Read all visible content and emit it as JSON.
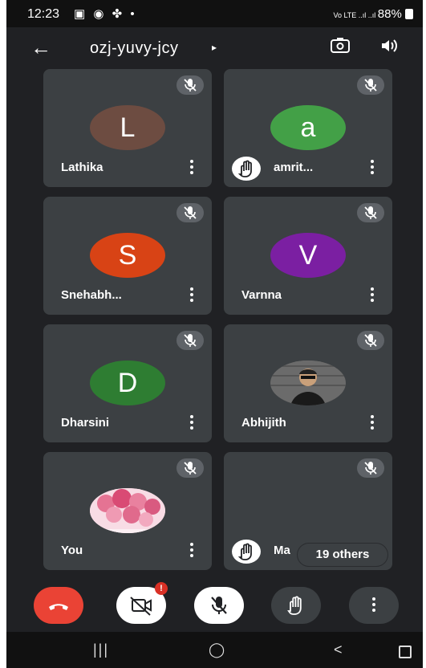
{
  "status_bar": {
    "time": "12:23",
    "left_icons": "▣ ◉ ✤ •",
    "right_text": "Vo LTE ..ıl ..ıl 88%",
    "battery": "88%"
  },
  "meeting": {
    "code": "ozj-yuvy-jcy",
    "caret": "▸"
  },
  "participants": [
    {
      "name": "Lathika",
      "initial": "L",
      "avatar_color": "#6d4c41",
      "muted": true,
      "hand_raised": false
    },
    {
      "name": "amrit...",
      "initial": "a",
      "avatar_color": "#43a047",
      "muted": true,
      "hand_raised": true
    },
    {
      "name": "Snehabh...",
      "initial": "S",
      "avatar_color": "#d84315",
      "muted": true,
      "hand_raised": false
    },
    {
      "name": "Varnna",
      "initial": "V",
      "avatar_color": "#7b1fa2",
      "muted": true,
      "hand_raised": false
    },
    {
      "name": "Dharsini",
      "initial": "D",
      "avatar_color": "#2e7d32",
      "muted": true,
      "hand_raised": false
    },
    {
      "name": "Abhijith",
      "initial": "",
      "avatar_color": "#9e9e9e",
      "muted": true,
      "hand_raised": false
    },
    {
      "name": "You",
      "initial": "",
      "avatar_color": "#f8bbd0",
      "muted": true,
      "hand_raised": false
    },
    {
      "name": "Ma",
      "initial": "",
      "avatar_color": "#3c4043",
      "muted": true,
      "hand_raised": true
    }
  ],
  "others_chip": "19 others",
  "controls": {
    "end_call_color": "#ea4335",
    "camera_badge": "!",
    "camera_badge_color": "#d93025"
  },
  "nav_bar": {
    "recent": "|||",
    "home": "◯",
    "back": "<"
  }
}
